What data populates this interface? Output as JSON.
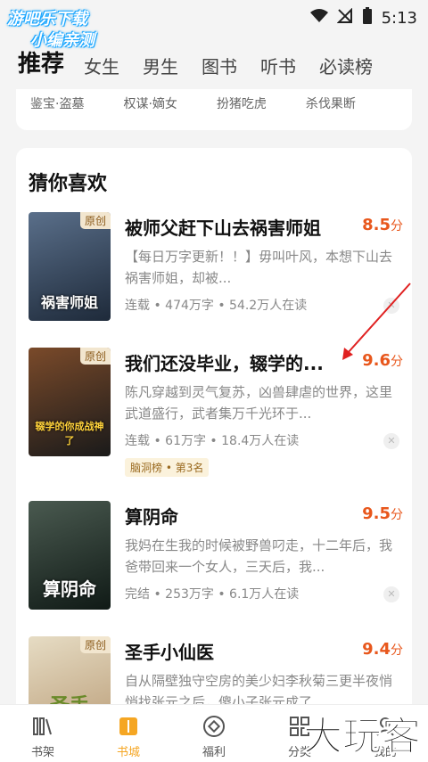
{
  "watermark_top": {
    "line1": "游吧乐下载",
    "line2": "小编亲测"
  },
  "watermark_bottom": "大玩客",
  "status": {
    "time": "5:13"
  },
  "tabs": [
    "推荐",
    "女生",
    "男生",
    "图书",
    "听书",
    "必读榜"
  ],
  "top_tags": [
    "鉴宝·盗墓",
    "权谋·嫡女",
    "扮猪吃虎",
    "杀伐果断"
  ],
  "section_title": "猜你喜欢",
  "books": [
    {
      "title": "被师父赶下山去祸害师姐",
      "score": "8.5",
      "unit": "分",
      "desc": "【每日万字更新！！】毋叫叶风，本想下山去祸害师姐，却被...",
      "meta": "连载 • 474万字 • 54.2万人在读",
      "badge": "原创",
      "cover_title": "祸害师姐",
      "cover_color": "#2f3e55"
    },
    {
      "title": "我们还没毕业，辍学的...",
      "score": "9.6",
      "unit": "分",
      "desc": "陈凡穿越到灵气复苏，凶兽肆虐的世界，这里武道盛行，武者集万千光环于...",
      "meta": "连载 • 61万字 • 18.4万人在读",
      "badge": "原创",
      "rank": "脑洞榜 • 第3名",
      "cover_title": "辍学的你成战神了",
      "cover_color": "#3a2a22"
    },
    {
      "title": "算阴命",
      "score": "9.5",
      "unit": "分",
      "desc": "我妈在生我的时候被野兽叼走，十二年后，我爸带回来一个女人，三天后，我...",
      "meta": "完结 • 253万字 • 6.1万人在读",
      "cover_title": "算阴命",
      "cover_color": "#2a3a32"
    },
    {
      "title": "圣手小仙医",
      "score": "9.4",
      "unit": "分",
      "desc": "自从隔壁独守空房的美少妇李秋菊三更半夜悄悄找张元之后，傻小子张元成了...",
      "badge": "原创",
      "cover_title": "圣手",
      "cover_color": "#c9b89a"
    }
  ],
  "bottom_nav": [
    {
      "label": "书架",
      "icon": "bookshelf-icon"
    },
    {
      "label": "书城",
      "icon": "bookstore-icon"
    },
    {
      "label": "福利",
      "icon": "gift-icon"
    },
    {
      "label": "分类",
      "icon": "category-icon"
    },
    {
      "label": "我的",
      "icon": "profile-icon"
    }
  ],
  "colors": {
    "accent": "#f5a623",
    "score": "#e8571c"
  }
}
